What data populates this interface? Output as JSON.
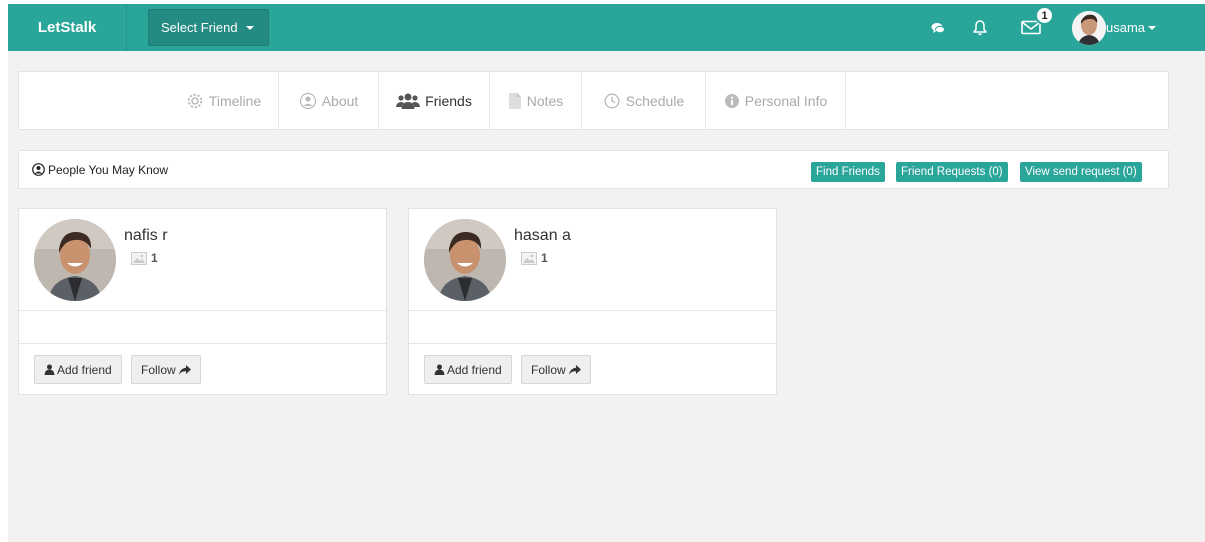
{
  "navbar": {
    "brand": "LetStalk",
    "select_friend_label": "Select Friend",
    "chat_icon": "comments-icon",
    "notification_icon": "bell-icon",
    "message_icon": "envelope-icon",
    "message_badge": "1",
    "username": "usama"
  },
  "tabs": [
    {
      "label": "Timeline",
      "icon": "gear-icon"
    },
    {
      "label": "About",
      "icon": "user-circle-icon"
    },
    {
      "label": "Friends",
      "icon": "users-icon"
    },
    {
      "label": "Notes",
      "icon": "file-icon"
    },
    {
      "label": "Schedule",
      "icon": "clock-icon"
    },
    {
      "label": "Personal Info",
      "icon": "info-icon"
    }
  ],
  "pymk": {
    "title": "People You May Know",
    "buttons": {
      "find_friends": "Find Friends",
      "friend_requests": "Friend Requests (0)",
      "view_sent": "View send request (0)"
    }
  },
  "cards": [
    {
      "name": "nafis r",
      "photo_count": "1",
      "add_friend": "Add friend",
      "follow": "Follow"
    },
    {
      "name": "hasan a",
      "photo_count": "1",
      "add_friend": "Add friend",
      "follow": "Follow"
    }
  ],
  "colors": {
    "brand": "#2aa59a",
    "background": "#f2f2f2"
  }
}
